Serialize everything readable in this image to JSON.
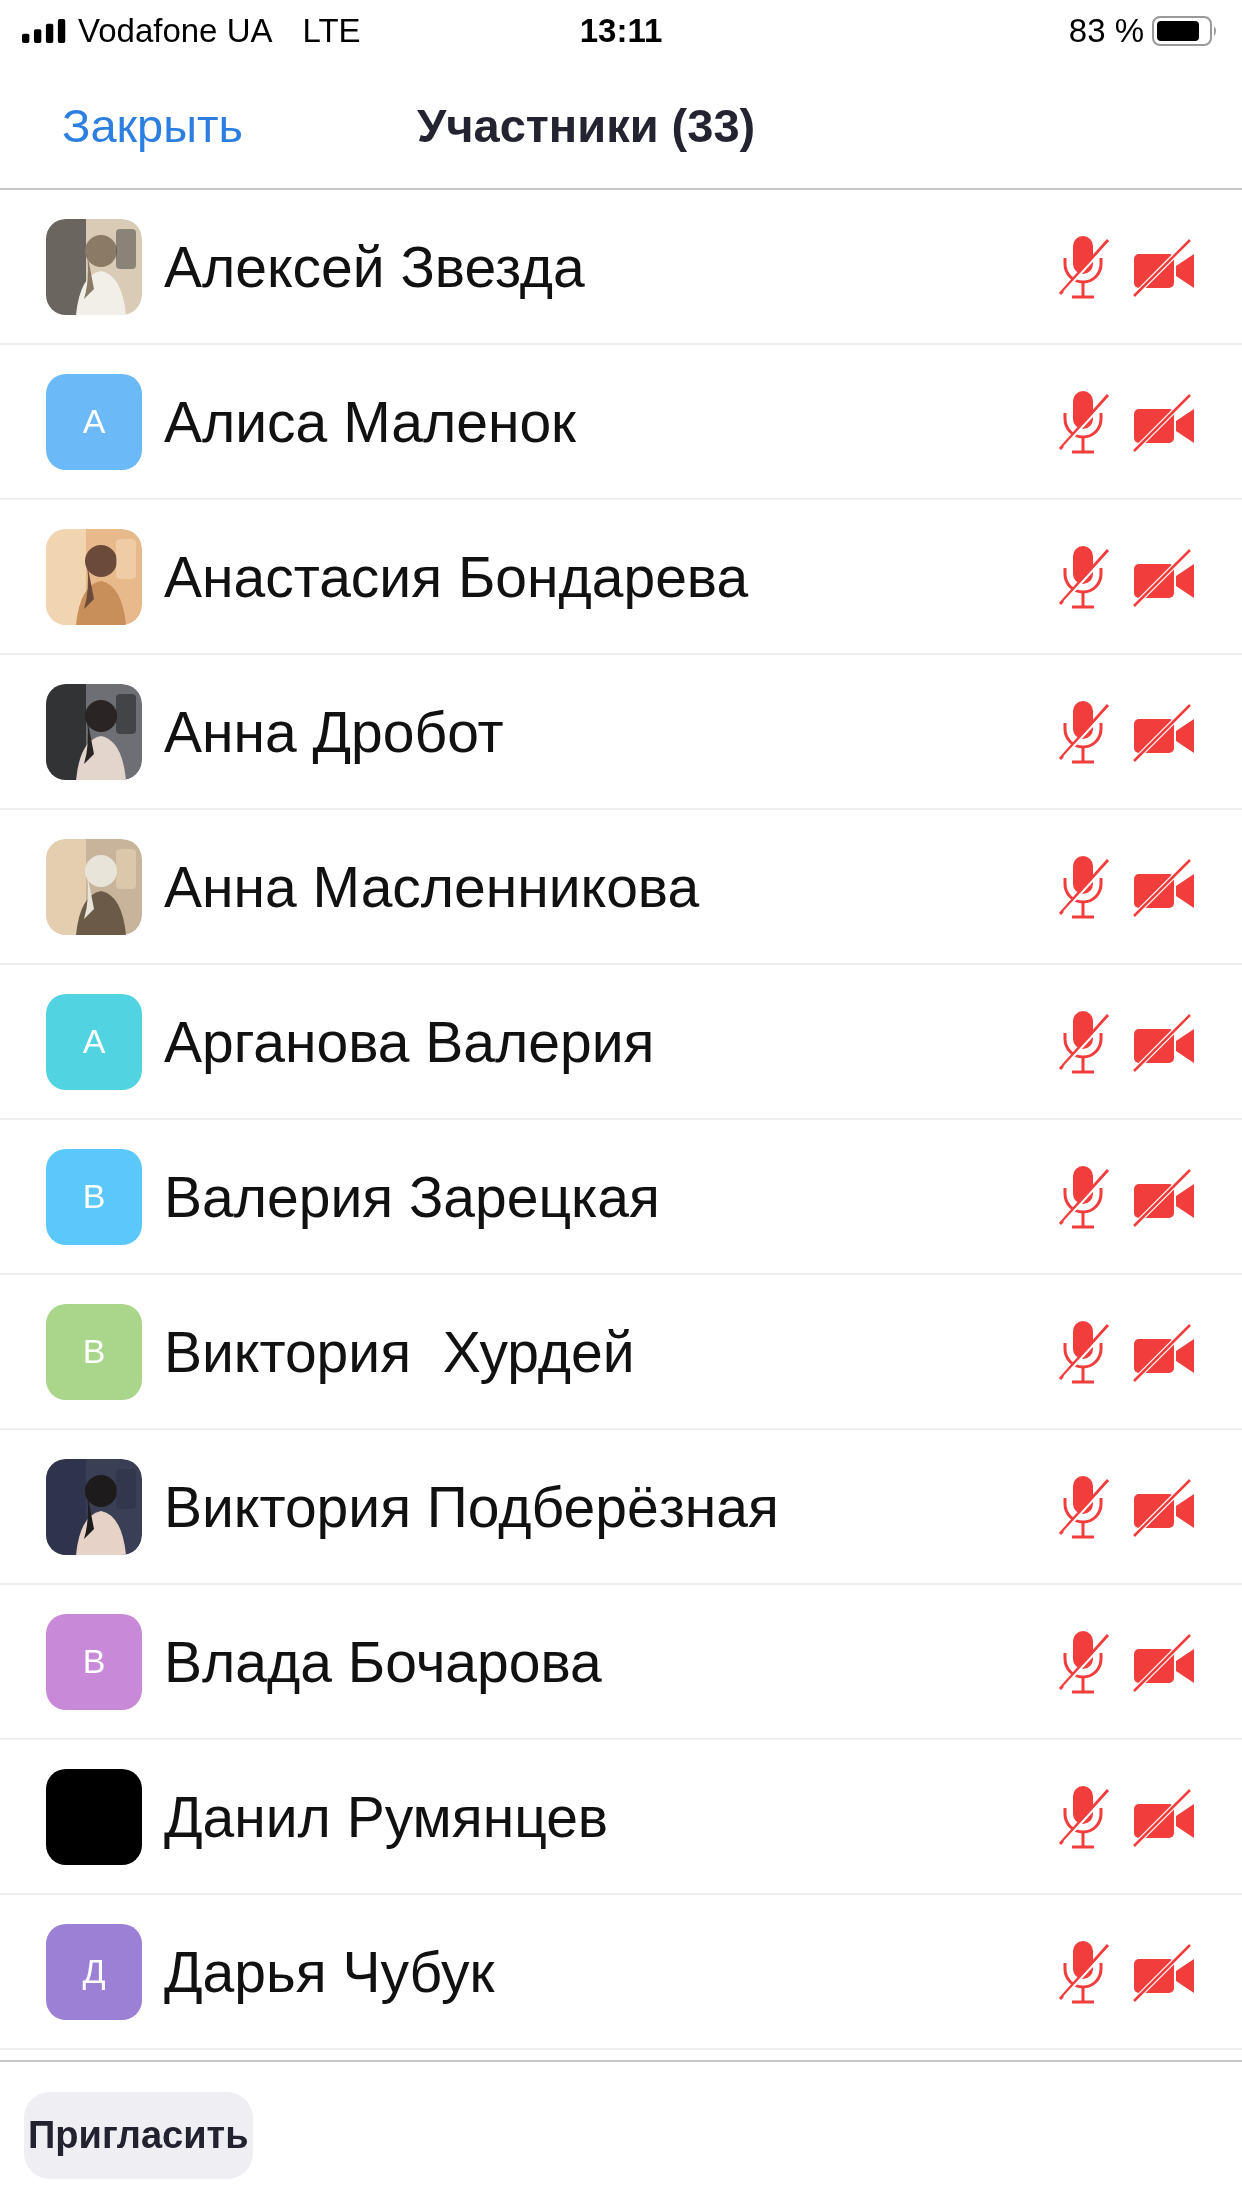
{
  "status_bar": {
    "carrier": "Vodafone UA",
    "network": "LTE",
    "time": "13:11",
    "battery": "83 %"
  },
  "nav": {
    "close": "Закрыть",
    "title": "Участники (33)"
  },
  "participants": [
    {
      "name": "Алексей Звезда",
      "mic_muted": true,
      "video_off": true
    },
    {
      "name": "Алиса Маленок",
      "avatar": {
        "kind": "initial",
        "letter": "А",
        "color": "#6cb9f8"
      },
      "mic_muted": true,
      "video_off": true
    },
    {
      "name": "Анастасия Бондарева",
      "mic_muted": true,
      "video_off": true
    },
    {
      "name": "Анна Дробот",
      "mic_muted": true,
      "video_off": true
    },
    {
      "name": "Анна Масленникова",
      "mic_muted": true,
      "video_off": true
    },
    {
      "name": "Арганова Валерия",
      "avatar": {
        "kind": "initial",
        "letter": "А",
        "color": "#52d3e2"
      },
      "mic_muted": true,
      "video_off": true
    },
    {
      "name": "Валерия Зарецкая",
      "avatar": {
        "kind": "initial",
        "letter": "В",
        "color": "#5ac8fa"
      },
      "mic_muted": true,
      "video_off": true
    },
    {
      "name": "Виктория  Хурдей",
      "avatar": {
        "kind": "initial",
        "letter": "В",
        "color": "#a9d68b"
      },
      "mic_muted": true,
      "video_off": true
    },
    {
      "name": "Виктория Подберёзная",
      "mic_muted": true,
      "video_off": true
    },
    {
      "name": "Влада Бочарова",
      "avatar": {
        "kind": "initial",
        "letter": "В",
        "color": "#c88ad8"
      },
      "mic_muted": true,
      "video_off": true
    },
    {
      "name": "Данил Румянцев",
      "avatar": {
        "kind": "blank",
        "color": "#000000"
      },
      "mic_muted": true,
      "video_off": true
    },
    {
      "name": "Дарья Чубук",
      "avatar": {
        "kind": "initial",
        "letter": "Д",
        "color": "#9b80d5"
      },
      "mic_muted": true,
      "video_off": true
    }
  ],
  "invite_button": "Пригласить"
}
